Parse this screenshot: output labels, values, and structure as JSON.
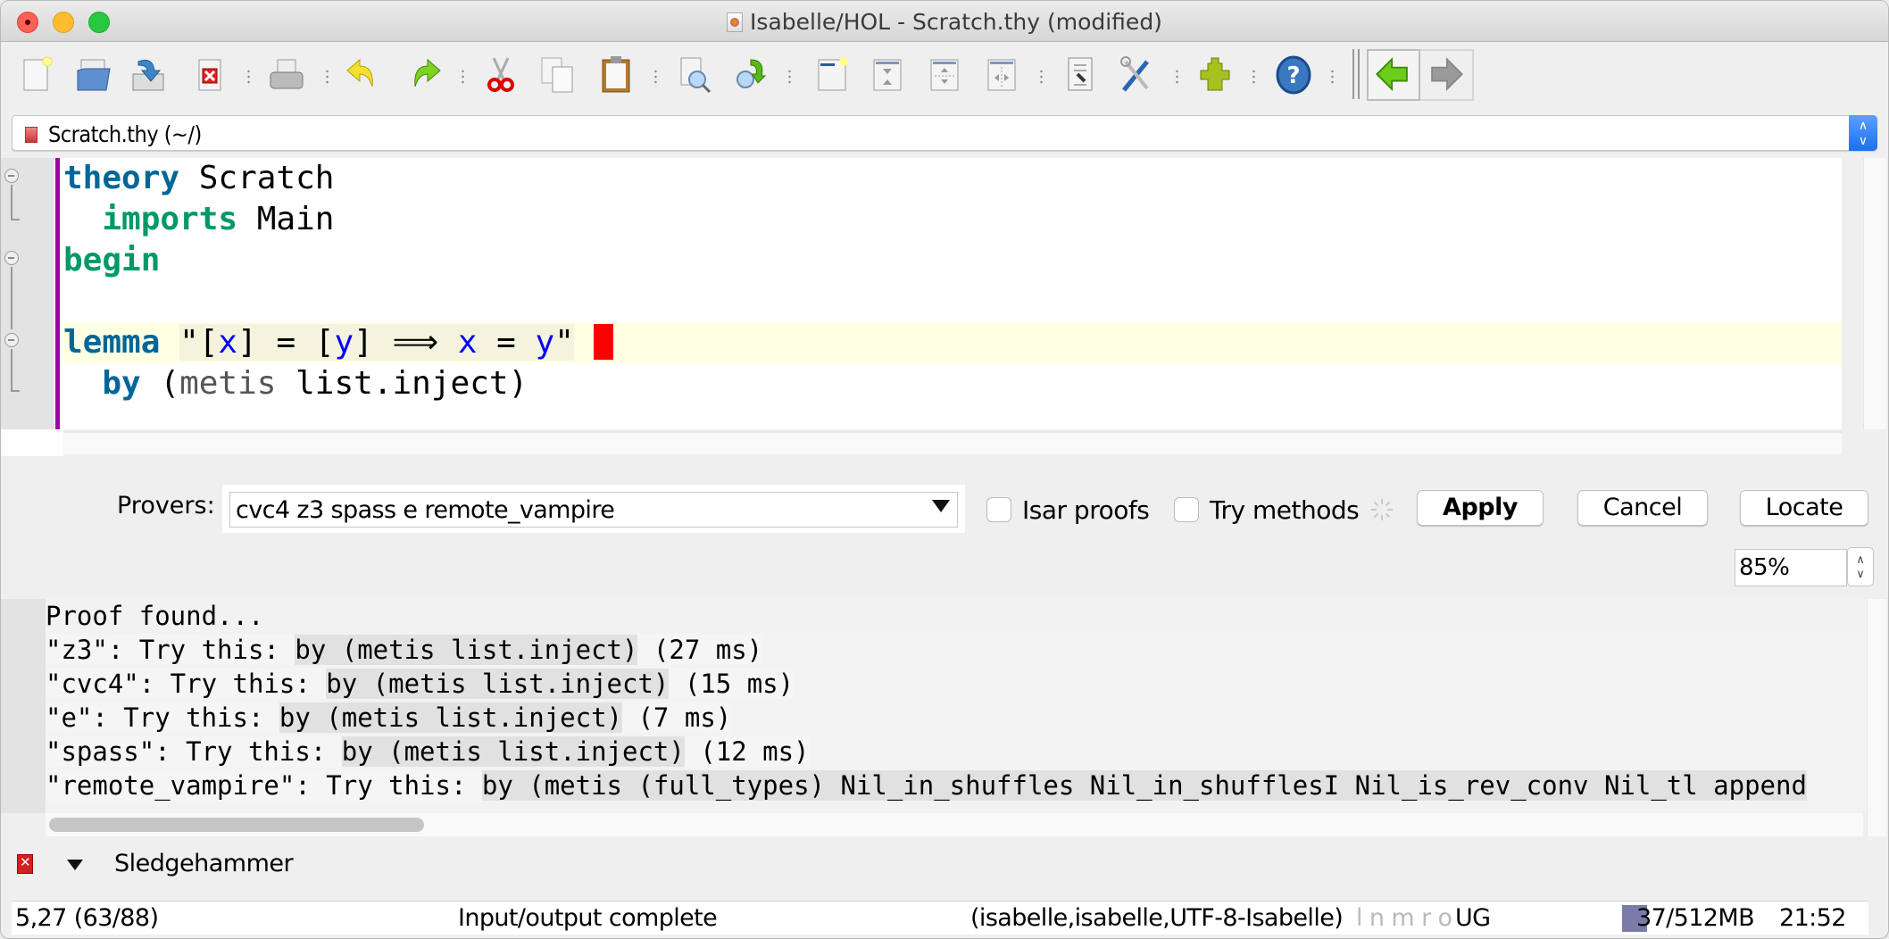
{
  "window": {
    "title": "Isabelle/HOL - Scratch.thy (modified)"
  },
  "toolbar": {
    "items": [
      {
        "name": "new-file",
        "tooltip": "New file"
      },
      {
        "name": "open-file"
      },
      {
        "name": "save-file"
      },
      {
        "name": "close-file"
      },
      {
        "name": "print"
      },
      {
        "name": "undo"
      },
      {
        "name": "redo"
      },
      {
        "name": "cut"
      },
      {
        "name": "copy"
      },
      {
        "name": "paste"
      },
      {
        "name": "find"
      },
      {
        "name": "find-next"
      },
      {
        "name": "new-view"
      },
      {
        "name": "unsplit"
      },
      {
        "name": "split-horizontal"
      },
      {
        "name": "split-vertical"
      },
      {
        "name": "buffer-options"
      },
      {
        "name": "global-options"
      },
      {
        "name": "plugin-manager"
      },
      {
        "name": "help"
      },
      {
        "name": "navigate-back"
      },
      {
        "name": "navigate-forward"
      }
    ]
  },
  "file_selector": {
    "value": "Scratch.thy (~/)"
  },
  "editor": {
    "lines": [
      {
        "kw": "theory",
        "rest": " Scratch"
      },
      {
        "indent": "  ",
        "kw": "imports",
        "rest": " Main"
      },
      {
        "kw": "begin"
      },
      {},
      {
        "kw": "lemma",
        "q1": "\"[",
        "x": "x",
        "m1": "] = [",
        "y": "y",
        "m2": "] ⟹ ",
        "x2": "x",
        "m3": " = ",
        "y2": "y",
        "q2": "\""
      },
      {
        "indent": "  ",
        "kw": "by",
        "open": " (",
        "method": "metis",
        "rest": " list.inject)"
      }
    ]
  },
  "sledgehammer": {
    "provers_label": "Provers:",
    "provers_value": "cvc4 z3 spass e remote_vampire",
    "isar_proofs_label": "Isar proofs",
    "isar_proofs_checked": false,
    "try_methods_label": "Try methods",
    "try_methods_checked": false,
    "apply_label": "Apply",
    "cancel_label": "Cancel",
    "locate_label": "Locate",
    "zoom_value": "85%",
    "dock_title": "Sledgehammer"
  },
  "output": {
    "header": "Proof found...",
    "results": [
      {
        "prefix": "\"z3\": Try this: ",
        "proof": "by (metis list.inject)",
        "time": " (27 ms)"
      },
      {
        "prefix": "\"cvc4\": Try this: ",
        "proof": "by (metis list.inject)",
        "time": " (15 ms)"
      },
      {
        "prefix": "\"e\": Try this: ",
        "proof": "by (metis list.inject)",
        "time": " (7 ms)"
      },
      {
        "prefix": "\"spass\": Try this: ",
        "proof": "by (metis list.inject)",
        "time": " (12 ms)"
      },
      {
        "prefix": "\"remote_vampire\": Try this: ",
        "proof": "by (metis (full_types) Nil_in_shuffles Nil_in_shufflesI Nil_is_rev_conv Nil_tl append",
        "time": ""
      }
    ]
  },
  "status_bar": {
    "position": "5,27 (63/88)",
    "message": "Input/output complete",
    "encoding": "(isabelle,isabelle,UTF-8-Isabelle)",
    "flags": "l n m r o",
    "mode": "UG",
    "memory": "37/512MB",
    "memory_used_fraction": 0.07,
    "time": "21:52"
  },
  "colors": {
    "keyword_blue": "#006699",
    "keyword_green": "#009966",
    "free_var": "#0000ff",
    "error_marker": "#ff0000",
    "current_line": "#ffffe3",
    "gutter_bar": "#a000a8"
  }
}
